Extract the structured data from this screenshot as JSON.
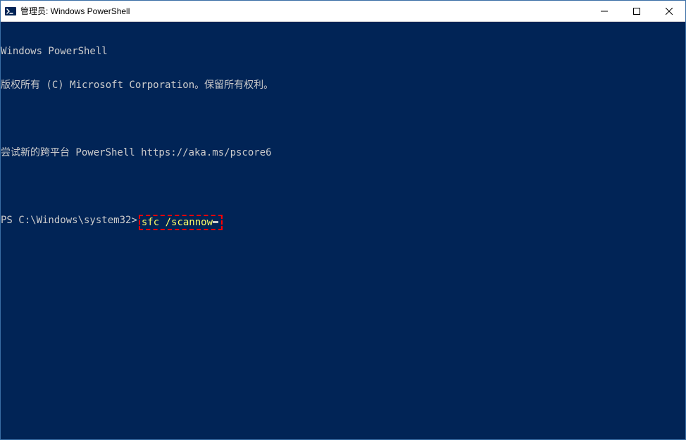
{
  "window": {
    "title": "管理员: Windows PowerShell"
  },
  "terminal": {
    "line1": "Windows PowerShell",
    "line2": "版权所有 (C) Microsoft Corporation。保留所有权利。",
    "line3": "",
    "line4": "尝试新的跨平台 PowerShell https://aka.ms/pscore6",
    "line5": "",
    "prompt": "PS C:\\Windows\\system32>",
    "command": "sfc /scannow"
  },
  "controls": {
    "minimize": "─",
    "maximize": "☐",
    "close": "✕"
  }
}
